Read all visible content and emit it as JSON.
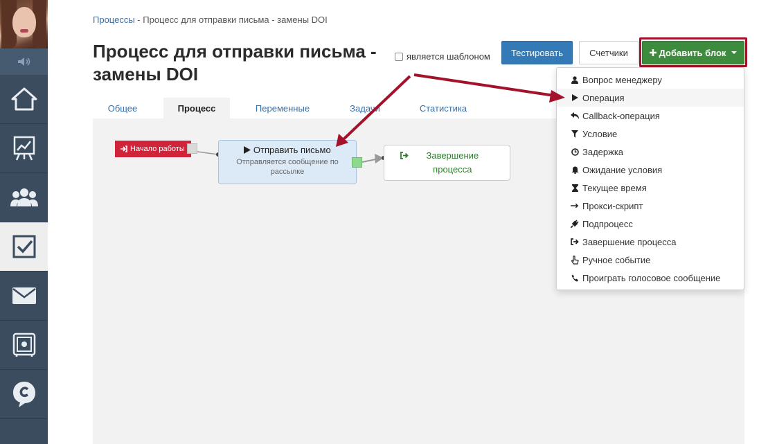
{
  "breadcrumb": {
    "root": "Процессы",
    "separator": " - ",
    "current": "Процесс для отправки письма - замены DOI"
  },
  "page": {
    "title": "Процесс для отправки письма - замены DOI",
    "template_label": "является шаблоном",
    "template_checked": false
  },
  "toolbar": {
    "test_label": "Тестировать",
    "counters_label": "Счетчики",
    "add_block_label": "Добавить блок"
  },
  "tabs": [
    {
      "label": "Общее",
      "active": false
    },
    {
      "label": "Процесс",
      "active": true
    },
    {
      "label": "Переменные",
      "active": false
    },
    {
      "label": "Задачи",
      "active": false
    },
    {
      "label": "Статистика",
      "active": false
    }
  ],
  "flow": {
    "start_label": "Начало работы",
    "operation_title": "Отправить письмо",
    "operation_desc": "Отправляется сообщение по рассылке",
    "end_label": "Завершение процесса"
  },
  "dropdown": {
    "items": [
      {
        "label": "Вопрос менеджеру",
        "icon": "user-icon"
      },
      {
        "label": "Операция",
        "icon": "play-icon"
      },
      {
        "label": "Callback-операция",
        "icon": "reply-icon"
      },
      {
        "label": "Условие",
        "icon": "filter-icon"
      },
      {
        "label": "Задержка",
        "icon": "clock-icon"
      },
      {
        "label": "Ожидание условия",
        "icon": "bell-icon"
      },
      {
        "label": "Текущее время",
        "icon": "hourglass-icon"
      },
      {
        "label": "Прокси-скрипт",
        "icon": "arrow-right-icon"
      },
      {
        "label": "Подпроцесс",
        "icon": "plug-icon"
      },
      {
        "label": "Завершение процесса",
        "icon": "sign-out-icon"
      },
      {
        "label": "Ручное событие",
        "icon": "hand-pointer-icon"
      },
      {
        "label": "Проиграть голосовое сообщение",
        "icon": "phone-icon"
      }
    ]
  },
  "colors": {
    "sidebar": "#3b4c5f",
    "primary": "#337ab7",
    "success": "#3d8b3d",
    "danger": "#d0243a",
    "annotation": "#a3122a"
  }
}
